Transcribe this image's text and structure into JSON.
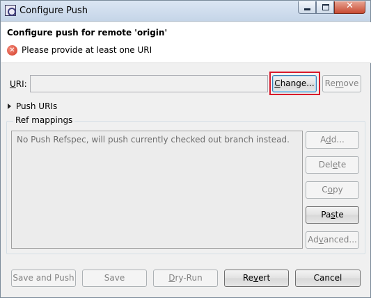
{
  "window": {
    "title": "Configure Push",
    "controls": {
      "minimize": "–",
      "maximize": "□",
      "close": "✕"
    }
  },
  "header": {
    "title": "Configure push for remote 'origin'",
    "error_message": "Please provide at least one URI",
    "error_icon": "error-icon"
  },
  "uri": {
    "label_mnemonic": "U",
    "label_rest": "RI:",
    "value": "",
    "change_button": {
      "before": "",
      "mnemonic": "C",
      "after": "hange..."
    },
    "remove_button": {
      "before": "Re",
      "mnemonic": "m",
      "after": "ove"
    }
  },
  "push_uris": {
    "label": "Push URIs",
    "expanded": false
  },
  "ref_mappings": {
    "label": "Ref mappings",
    "empty_message": "No Push Refspec, will push currently checked out branch instead.",
    "buttons": {
      "add": {
        "before": "A",
        "mnemonic": "d",
        "after": "d...",
        "enabled": false
      },
      "delete": {
        "before": "Del",
        "mnemonic": "e",
        "after": "te",
        "enabled": false
      },
      "copy": {
        "before": "C",
        "mnemonic": "o",
        "after": "py",
        "enabled": false
      },
      "paste": {
        "before": "Pa",
        "mnemonic": "s",
        "after": "te",
        "enabled": true
      },
      "advanced": {
        "before": "Ad",
        "mnemonic": "v",
        "after": "anced...",
        "enabled": false
      }
    }
  },
  "footer": {
    "save_and_push": "Save and Push",
    "save": "Save",
    "dry_run": {
      "before": "",
      "mnemonic": "D",
      "after": "ry-Run"
    },
    "revert": {
      "before": "Re",
      "mnemonic": "v",
      "after": "ert"
    },
    "cancel": "Cancel"
  },
  "colors": {
    "highlight": "#d9182a",
    "error": "#d23a26"
  }
}
